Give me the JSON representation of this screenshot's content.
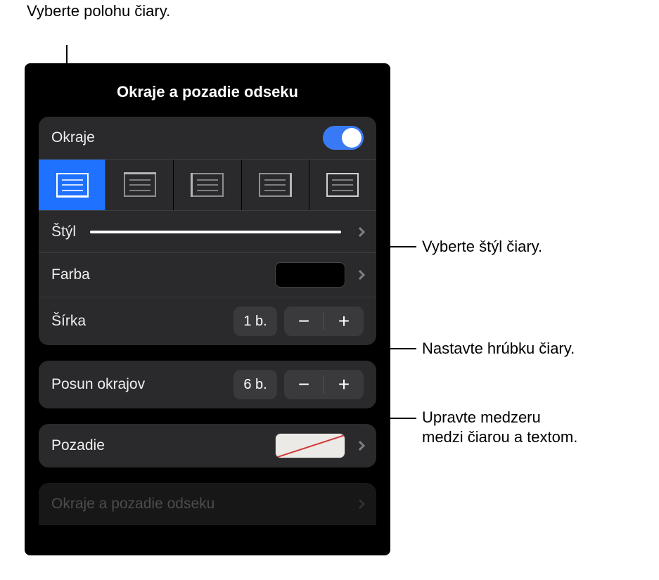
{
  "callouts": {
    "position": "Vyberte polohu čiary.",
    "style": "Vyberte štýl čiary.",
    "width": "Nastavte hrúbku čiary.",
    "offset_l1": "Upravte medzeru",
    "offset_l2": "medzi čiarou a textom."
  },
  "panel": {
    "title": "Okraje a pozadie odseku",
    "borders_label": "Okraje",
    "style_label": "Štýl",
    "color_label": "Farba",
    "width_label": "Šírka",
    "width_value": "1 b.",
    "offset_label": "Posun okrajov",
    "offset_value": "6 b.",
    "background_label": "Pozadie",
    "peek_label": "Okraje a pozadie odseku",
    "borders_on": true,
    "positions": [
      "bottom",
      "top",
      "left",
      "right",
      "all"
    ],
    "selected_position": 0,
    "color_value": "#000000",
    "background_value": "none"
  }
}
